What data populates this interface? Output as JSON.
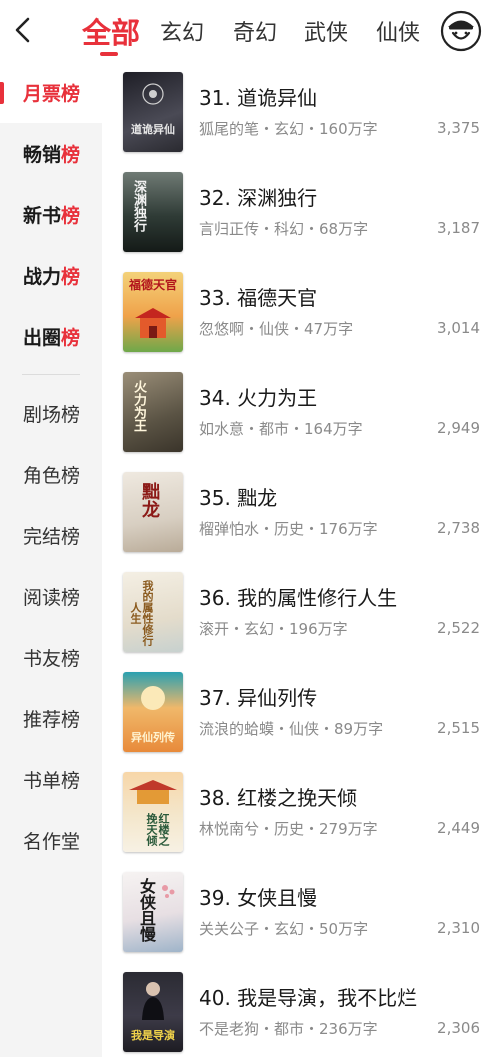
{
  "header": {
    "tabs": [
      {
        "label": "全部",
        "active": true
      },
      {
        "label": "玄幻",
        "active": false
      },
      {
        "label": "奇幻",
        "active": false
      },
      {
        "label": "武侠",
        "active": false
      },
      {
        "label": "仙侠",
        "active": false
      }
    ],
    "back_icon": "chevron-left-icon",
    "avatar_icon": "user-avatar-icon"
  },
  "sidebar": {
    "items": [
      {
        "label": "月票榜",
        "active": true
      },
      {
        "label": "畅销榜"
      },
      {
        "label": "新书榜"
      },
      {
        "label": "战力榜"
      },
      {
        "label": "出圈榜"
      },
      {
        "label": "剧场榜"
      },
      {
        "label": "角色榜"
      },
      {
        "label": "完结榜"
      },
      {
        "label": "阅读榜"
      },
      {
        "label": "书友榜"
      },
      {
        "label": "推荐榜"
      },
      {
        "label": "书单榜"
      },
      {
        "label": "名作堂"
      }
    ]
  },
  "books": [
    {
      "title": "31. 道诡异仙",
      "meta": "狐尾的笔・玄幻・160万字",
      "votes": "3,375",
      "cover_text": "道诡异仙"
    },
    {
      "title": "32. 深渊独行",
      "meta": "言归正传・科幻・68万字",
      "votes": "3,187",
      "cover_text": "深渊独行"
    },
    {
      "title": "33. 福德天官",
      "meta": "忽悠啊・仙侠・47万字",
      "votes": "3,014",
      "cover_text": "福德天官"
    },
    {
      "title": "34. 火力为王",
      "meta": "如水意・都市・164万字",
      "votes": "2,949",
      "cover_text": "火力为王"
    },
    {
      "title": "35. 黜龙",
      "meta": "榴弹怕水・历史・176万字",
      "votes": "2,738",
      "cover_text": "黜龙"
    },
    {
      "title": "36. 我的属性修行人生",
      "meta": "滚开・玄幻・196万字",
      "votes": "2,522",
      "cover_text": "我的属性修行人生"
    },
    {
      "title": "37. 异仙列传",
      "meta": "流浪的蛤蟆・仙侠・89万字",
      "votes": "2,515",
      "cover_text": "异仙列传"
    },
    {
      "title": "38. 红楼之挽天倾",
      "meta": "林悦南兮・历史・279万字",
      "votes": "2,449",
      "cover_text": "红楼之挽天倾"
    },
    {
      "title": "39. 女侠且慢",
      "meta": "关关公子・玄幻・50万字",
      "votes": "2,310",
      "cover_text": "女侠且慢"
    },
    {
      "title": "40. 我是导演，我不比烂",
      "meta": "不是老狗・都市・236万字",
      "votes": "2,306",
      "cover_text": "我是导演"
    }
  ],
  "colors": {
    "accent": "#e8313b",
    "sidebar_bg": "#f4f4f4",
    "muted_text": "#8a8a8a"
  }
}
